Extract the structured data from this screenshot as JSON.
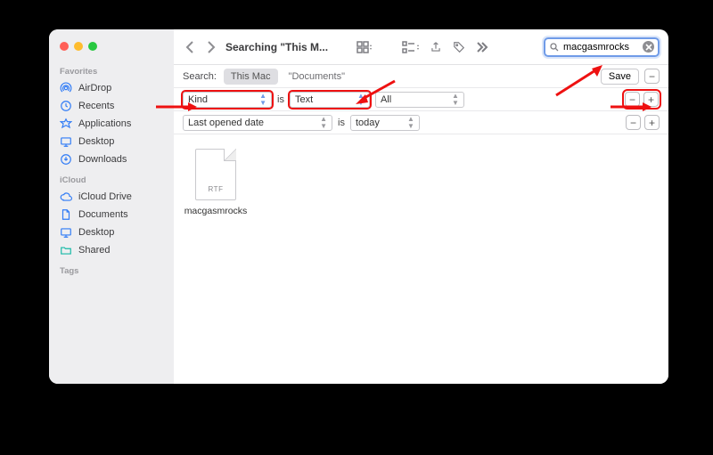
{
  "window_title": "Searching \"This M...",
  "search": {
    "value": "macgasmrocks"
  },
  "sidebar": {
    "sections": [
      {
        "title": "Favorites",
        "items": [
          {
            "icon": "airdrop",
            "label": "AirDrop"
          },
          {
            "icon": "recents",
            "label": "Recents"
          },
          {
            "icon": "applications",
            "label": "Applications"
          },
          {
            "icon": "desktop",
            "label": "Desktop"
          },
          {
            "icon": "downloads",
            "label": "Downloads"
          }
        ]
      },
      {
        "title": "iCloud",
        "items": [
          {
            "icon": "icloud",
            "label": "iCloud Drive"
          },
          {
            "icon": "documents",
            "label": "Documents"
          },
          {
            "icon": "desktop",
            "label": "Desktop"
          },
          {
            "icon": "shared",
            "label": "Shared"
          }
        ]
      },
      {
        "title": "Tags",
        "items": []
      }
    ]
  },
  "scope": {
    "label": "Search:",
    "active": "This Mac",
    "other": "\"Documents\"",
    "save_label": "Save"
  },
  "rules": [
    {
      "attr": "Kind",
      "op": "is",
      "value": "Text",
      "extra": "All",
      "highlight": true
    },
    {
      "attr": "Last opened date",
      "op": "is",
      "value": "today",
      "highlight": false
    }
  ],
  "results": [
    {
      "name": "macgasmrocks",
      "badge": "RTF"
    }
  ],
  "colors": {
    "accent": "#6f9be8",
    "annotation": "#e11"
  }
}
